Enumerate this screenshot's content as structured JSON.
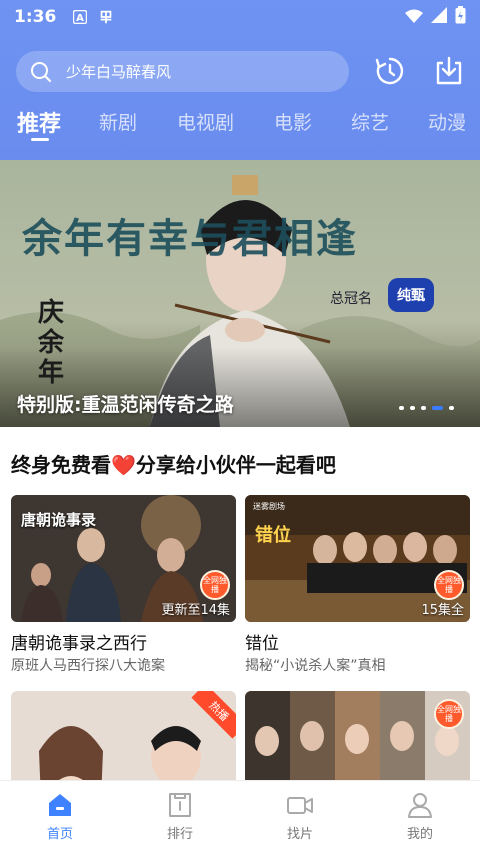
{
  "status_bar": {
    "time": "1:36",
    "icons": [
      "a-notification-icon",
      "app-notification-icon",
      "wifi-icon",
      "signal-icon",
      "battery-icon"
    ]
  },
  "search": {
    "placeholder": "少年白马醉春风"
  },
  "header_icons": [
    "history-icon",
    "download-icon"
  ],
  "tabs": [
    {
      "label": "推荐",
      "active": true
    },
    {
      "label": "新剧",
      "active": false
    },
    {
      "label": "电视剧",
      "active": false
    },
    {
      "label": "电影",
      "active": false
    },
    {
      "label": "综艺",
      "active": false
    },
    {
      "label": "动漫",
      "active": false
    }
  ],
  "banner": {
    "title": "特别版:重温范闲传奇之路",
    "headline": "余年有幸与君相逢",
    "sponsor_label": "总冠名",
    "sponsor_logo": "纯甄",
    "show_logo": "庆余年",
    "dots": 5,
    "active_dot": 4
  },
  "section": {
    "title": "终身免费看❤️分享给小伙伴一起看吧"
  },
  "cards": [
    {
      "title": "唐朝诡事录之西行",
      "subtitle": "原班人马西行探八大诡案",
      "status": "更新至14集",
      "badge": "全网独播",
      "poster_title": "唐朝诡事录"
    },
    {
      "title": "错位",
      "subtitle": "揭秘“小说杀人案”真相",
      "status": "15集全",
      "badge": "全网独播",
      "poster_title": "错位",
      "poster_brand": "迷雾剧场"
    },
    {
      "corner_tag": "热播"
    },
    {
      "badge": "全网独播"
    }
  ],
  "bottom_nav": [
    {
      "label": "首页",
      "icon": "home-icon",
      "active": true
    },
    {
      "label": "排行",
      "icon": "ranking-icon",
      "active": false
    },
    {
      "label": "找片",
      "icon": "video-camera-icon",
      "active": false
    },
    {
      "label": "我的",
      "icon": "user-icon",
      "active": false
    }
  ],
  "colors": {
    "header": "#6b8ff0",
    "accent": "#3f82ff",
    "badge": "#ff5a2b"
  }
}
